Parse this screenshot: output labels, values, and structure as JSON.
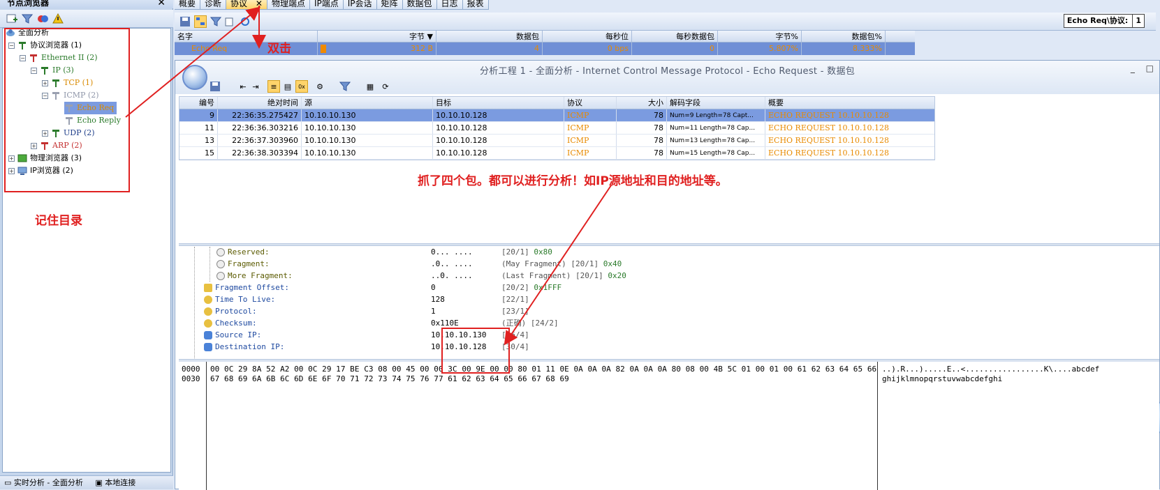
{
  "left_panel": {
    "title": "节点浏览器",
    "close_glyph": "✕",
    "toolbar_icons": [
      "add-node-icon",
      "filter-icon",
      "group-icon",
      "alert-icon"
    ],
    "tree": [
      {
        "label": "全面分析",
        "icon": "network-icon",
        "expander": ""
      },
      {
        "label": "协议浏览器 (1)",
        "icon": "protocol-icon",
        "expander": "−"
      },
      {
        "label": "Ethernet II (2)",
        "icon": "protocol-icon",
        "expander": "−"
      },
      {
        "label": "IP (3)",
        "icon": "protocol-icon",
        "expander": "−"
      },
      {
        "label": "TCP (1)",
        "icon": "protocol-icon",
        "expander": "+"
      },
      {
        "label": "ICMP (2)",
        "icon": "protocol-icon",
        "expander": "−"
      },
      {
        "label": "Echo Req",
        "icon": "protocol-icon",
        "expander": ""
      },
      {
        "label": "Echo Reply",
        "icon": "protocol-icon",
        "expander": ""
      },
      {
        "label": "UDP (2)",
        "icon": "protocol-icon",
        "expander": "+"
      },
      {
        "label": "ARP (2)",
        "icon": "protocol-icon",
        "expander": "+"
      },
      {
        "label": "物理浏览器 (3)",
        "icon": "physical-icon",
        "expander": "+"
      },
      {
        "label": "IP浏览器 (2)",
        "icon": "ip-icon",
        "expander": "+"
      }
    ],
    "status_left": "实时分析 - 全面分析",
    "status_right": "本地连接"
  },
  "tabs": [
    {
      "label": "概要"
    },
    {
      "label": "诊断"
    },
    {
      "label": "协议"
    },
    {
      "label": "物理端点"
    },
    {
      "label": "IP端点"
    },
    {
      "label": "IP会话"
    },
    {
      "label": "矩阵"
    },
    {
      "label": "数据包"
    },
    {
      "label": "日志"
    },
    {
      "label": "报表"
    }
  ],
  "tab_close_glyph": "✕",
  "echo_req_filter": {
    "label": "Echo Req\\协议:",
    "value": "1"
  },
  "stats_table": {
    "headers": [
      "名字",
      "字节 ▼",
      "数据包",
      "每秒位",
      "每秒数据包",
      "字节%",
      "数据包%"
    ],
    "row": [
      "Echo Req",
      "312 B",
      "4",
      "0 bps",
      "0",
      "5.807%",
      "8.333%"
    ]
  },
  "inner_window": {
    "title": "分析工程 1 - 全面分析 - Internet Control Message Protocol - Echo Request - 数据包",
    "ctrl_min": "_",
    "ctrl_max": "□"
  },
  "packet_table": {
    "headers": [
      "编号",
      "绝对时间",
      "源",
      "目标",
      "协议",
      "大小",
      "解码字段",
      "概要"
    ],
    "rows": [
      {
        "no": "9",
        "time": "22:36:35.275427",
        "src": "10.10.10.130",
        "dst": "10.10.10.128",
        "proto": "ICMP",
        "size": "78",
        "decode": "Num=9 Length=78 Capt...",
        "summary": "ECHO REQUEST 10.10.10.128"
      },
      {
        "no": "11",
        "time": "22:36:36.303216",
        "src": "10.10.10.130",
        "dst": "10.10.10.128",
        "proto": "ICMP",
        "size": "78",
        "decode": "Num=11 Length=78 Cap...",
        "summary": "ECHO REQUEST 10.10.10.128"
      },
      {
        "no": "13",
        "time": "22:36:37.303960",
        "src": "10.10.10.130",
        "dst": "10.10.10.128",
        "proto": "ICMP",
        "size": "78",
        "decode": "Num=13 Length=78 Cap...",
        "summary": "ECHO REQUEST 10.10.10.128"
      },
      {
        "no": "15",
        "time": "22:36:38.303394",
        "src": "10.10.10.130",
        "dst": "10.10.10.128",
        "proto": "ICMP",
        "size": "78",
        "decode": "Num=15 Length=78 Cap...",
        "summary": "ECHO REQUEST 10.10.10.128"
      }
    ]
  },
  "decode_fields": [
    {
      "name": "Reserved:",
      "value": "0... ....",
      "info": "[20/1]",
      "hex": "0x80"
    },
    {
      "name": "Fragment:",
      "value": ".0.. ....",
      "info": "(May Fragment) [20/1]",
      "hex": "0x40"
    },
    {
      "name": "More Fragment:",
      "value": "..0. ....",
      "info": "(Last Fragment) [20/1]",
      "hex": "0x20"
    },
    {
      "name": "Fragment Offset:",
      "value": "0",
      "info": "[20/2]",
      "hex": "0x1FFF"
    },
    {
      "name": "Time To Live:",
      "value": "128",
      "info": "[22/1]",
      "hex": ""
    },
    {
      "name": "Protocol:",
      "value": "1",
      "info": "[23/1]",
      "hex": ""
    },
    {
      "name": "Checksum:",
      "value": "0x110E",
      "info": "(正确) [24/2]",
      "hex": ""
    },
    {
      "name": "Source IP:",
      "value": "10.10.10.130",
      "info": "[26/4]",
      "hex": ""
    },
    {
      "name": "Destination IP:",
      "value": "10.10.10.128",
      "info": "[30/4]",
      "hex": ""
    }
  ],
  "hex_view": {
    "offsets": [
      "0000",
      "0030"
    ],
    "bytes": [
      "00 0C 29 8A 52 A2 00 0C 29 17 BE C3 08 00 45 00 00 3C 00 9E 00 00 80 01 11 0E 0A 0A 0A 82 0A 0A 0A 80 08 00 4B 5C 01 00 01 00 61 62 63 64 65 66",
      "67 68 69 6A 6B 6C 6D 6E 6F 70 71 72 73 74 75 76 77 61 62 63 64 65 66 67 68 69"
    ],
    "ascii": [
      "..).R...).....E..<.................K\\....abcdef",
      "ghijklmnopqrstuvwabcdefghi"
    ]
  },
  "annotations": {
    "double_click": "双击",
    "remember_dir": "记住目录",
    "four_packets": "抓了四个包。都可以进行分析！如IP源地址和目的地址等。"
  },
  "colors": {
    "annotation_red": "#e02020",
    "selected_row": "#7b9be0",
    "icmp_orange": "#e88a00",
    "panel_bg": "#dfe8f6"
  }
}
